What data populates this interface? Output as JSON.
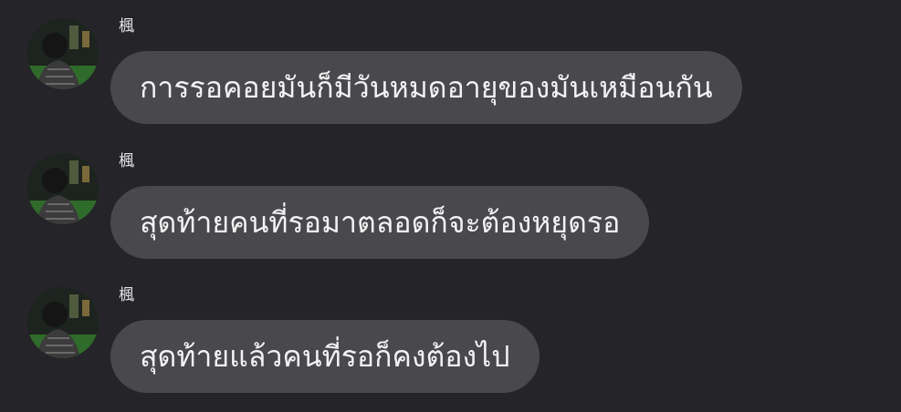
{
  "conversation": {
    "messages": [
      {
        "sender": "楓",
        "text": "การรอคอยมันก็มีวันหมดอายุของมันเหมือนกัน"
      },
      {
        "sender": "楓",
        "text": "สุดท้ายคนที่รอมาตลอดก็จะต้องหยุดรอ"
      },
      {
        "sender": "楓",
        "text": "สุดท้ายแล้วคนที่รอก็คงต้องไป"
      }
    ]
  },
  "icons": {
    "avatar": "profile-photo"
  },
  "colors": {
    "background": "#242429",
    "bubble": "#48484d",
    "text": "#f2f2f2"
  }
}
